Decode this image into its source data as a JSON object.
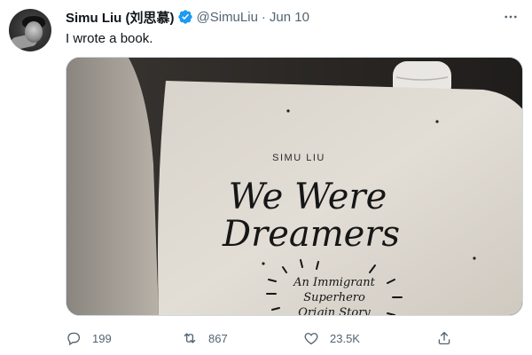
{
  "tweet": {
    "author_name": "Simu Liu (刘思慕)",
    "handle": "@SimuLiu",
    "separator": "·",
    "time": "Jun 10",
    "text": "I wrote a book.",
    "more_icon": "more-horizontal-icon",
    "verified_icon": "verified-badge-icon"
  },
  "media": {
    "book_author": "SIMU LIU",
    "title_line1": "We Were",
    "title_line2": "Dreamers",
    "subtitle_line1": "An Immigrant",
    "subtitle_line2": "Superhero",
    "subtitle_line3": "Origin Story"
  },
  "actions": {
    "reply_count": "199",
    "retweet_count": "867",
    "like_count": "23.5K",
    "reply_icon": "reply-icon",
    "retweet_icon": "retweet-icon",
    "like_icon": "heart-icon",
    "share_icon": "share-icon"
  },
  "colors": {
    "verified": "#1d9bf0",
    "secondary_text": "#536471",
    "primary_text": "#0f1419"
  }
}
